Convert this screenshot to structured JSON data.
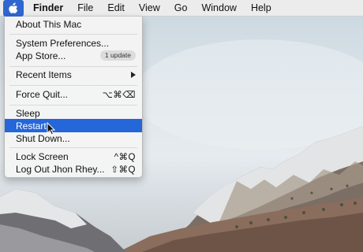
{
  "menubar": {
    "apple_icon": "apple-logo-icon",
    "items": [
      "Finder",
      "File",
      "Edit",
      "View",
      "Go",
      "Window",
      "Help"
    ]
  },
  "apple_menu": {
    "about": "About This Mac",
    "system_preferences": "System Preferences...",
    "app_store": "App Store...",
    "app_store_badge": "1 update",
    "recent_items": "Recent Items",
    "force_quit": "Force Quit...",
    "force_quit_shortcut": "⌥⌘⌫",
    "sleep": "Sleep",
    "restart": "Restart...",
    "shut_down": "Shut Down...",
    "lock_screen": "Lock Screen",
    "lock_screen_shortcut": "^⌘Q",
    "log_out": "Log Out Jhon Rhey...",
    "log_out_shortcut": "⇧⌘Q"
  },
  "colors": {
    "highlight": "#2566d8",
    "menubar_bg": "#ececec",
    "apple_button": "#2f66d0"
  }
}
